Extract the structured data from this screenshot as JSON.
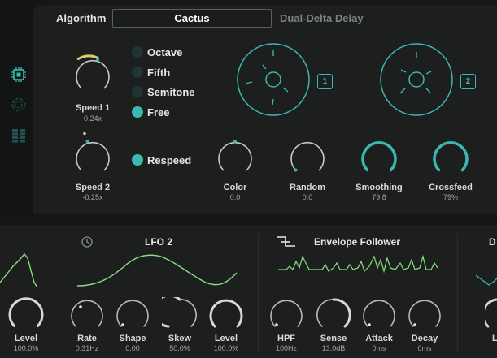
{
  "header": {
    "algorithm_label": "Algorithm",
    "algorithm_value": "Cactus",
    "algorithm_name": "Dual-Delta Delay"
  },
  "sidebar": {
    "items": [
      {
        "icon": "chip-icon",
        "active": true
      },
      {
        "icon": "dotted-circle-icon",
        "active": false
      },
      {
        "icon": "grid-icon",
        "active": false
      }
    ]
  },
  "knobs": {
    "speed1": {
      "label": "Speed 1",
      "value": "0.24x"
    },
    "speed2": {
      "label": "Speed 2",
      "value": "-0.25x"
    },
    "color": {
      "label": "Color",
      "value": "0.0"
    },
    "random": {
      "label": "Random",
      "value": "0.0"
    },
    "smoothing": {
      "label": "Smoothing",
      "value": "79.8"
    },
    "crossfeed": {
      "label": "Crossfeed",
      "value": "79%"
    }
  },
  "speed_mode": {
    "options": [
      "Octave",
      "Fifth",
      "Semitone",
      "Free"
    ],
    "selected": "Free"
  },
  "respeed": {
    "label": "Respeed",
    "on": true
  },
  "taps": {
    "tap1": "1",
    "tap2": "2"
  },
  "lfo1": {
    "level": {
      "label": "Level",
      "value": "100.0%"
    }
  },
  "lfo2": {
    "title": "LFO 2",
    "rate": {
      "label": "Rate",
      "value": "0.31Hz"
    },
    "shape": {
      "label": "Shape",
      "value": "0.00"
    },
    "skew": {
      "label": "Skew",
      "value": "50.0%"
    },
    "level": {
      "label": "Level",
      "value": "100.0%"
    }
  },
  "envelope": {
    "title": "Envelope Follower",
    "hpf": {
      "label": "HPF",
      "value": "100Hz"
    },
    "sense": {
      "label": "Sense",
      "value": "13.0dB"
    },
    "attack": {
      "label": "Attack",
      "value": "0ms"
    },
    "decay": {
      "label": "Decay",
      "value": "0ms"
    }
  },
  "partial_section": {
    "title_fragment": "D",
    "knob_fragment": "L"
  },
  "colors": {
    "accent": "#3ab9af",
    "yellow": "#d8cf6a",
    "green_wave": "#86e07e",
    "background": "#151616",
    "panel": "#1d1e1e"
  }
}
